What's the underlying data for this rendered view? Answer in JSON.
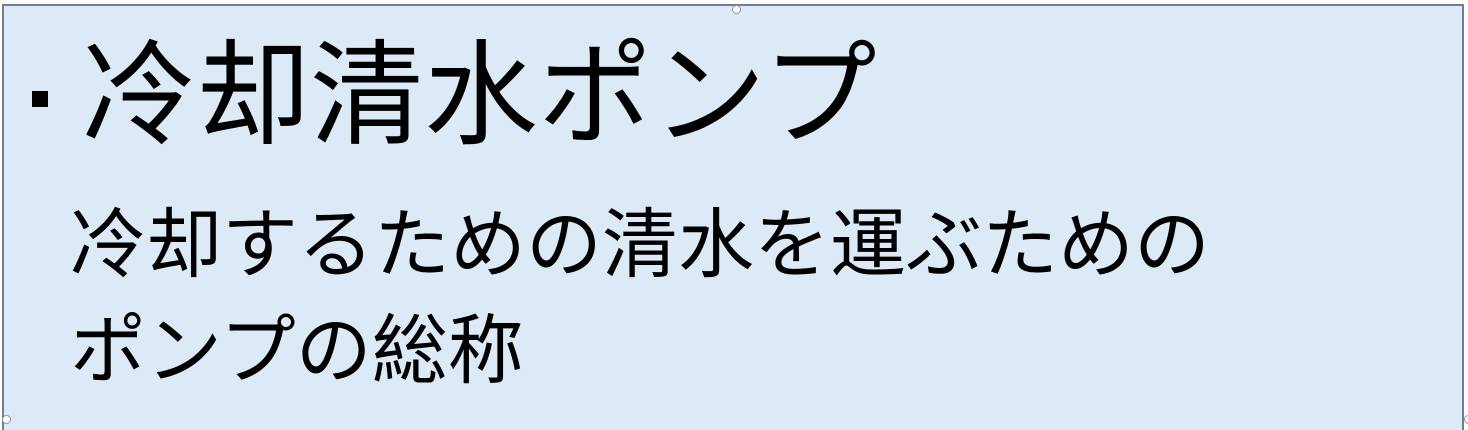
{
  "textbox": {
    "title": "冷却清水ポンプ",
    "description_lines": [
      "冷却するための清水を運ぶための",
      "ポンプの総称"
    ]
  },
  "colors": {
    "background": "#dce9f6",
    "border": "#6f7f92",
    "text": "#000000"
  },
  "icons": {
    "bullet": "square-bullet-icon"
  }
}
